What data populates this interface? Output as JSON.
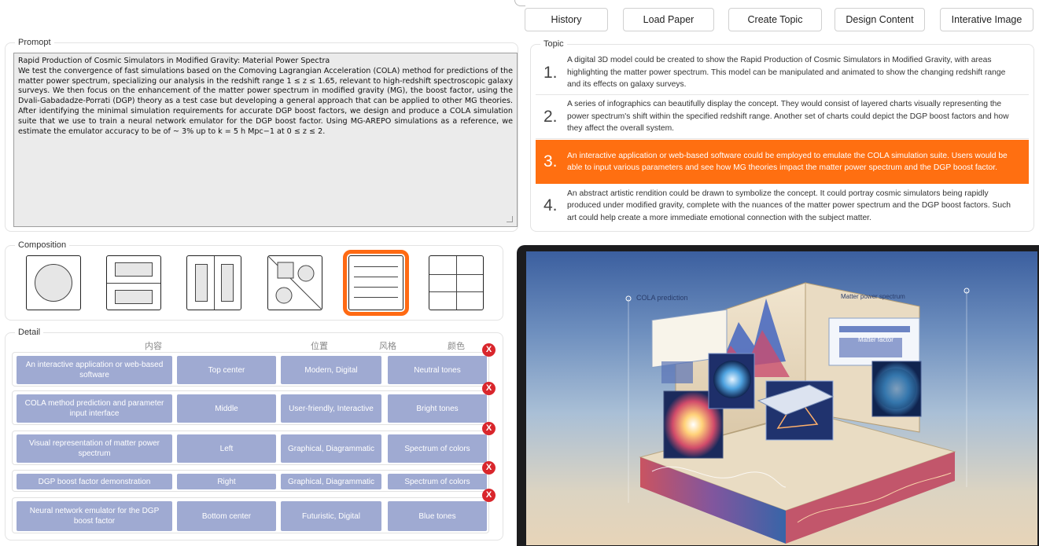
{
  "toolbar": {
    "buttons": [
      "History",
      "Load Paper",
      "Create Topic",
      "Design Content",
      "Interative Image"
    ]
  },
  "prompt": {
    "legend": "Promopt",
    "text": "Rapid Production of Cosmic Simulators in Modified Gravity: Material Power Spectra\nWe test the convergence of fast simulations based on the Comoving Lagrangian Acceleration (COLA) method for predictions of the matter power spectrum, specializing our analysis in the redshift range 1 ≤ z ≤ 1.65, relevant to high-redshift spectroscopic galaxy surveys. We then focus on the enhancement of the matter power spectrum in modified gravity (MG), the boost factor, using the Dvali-Gabadadze-Porrati (DGP) theory as a test case but developing a general approach that can be applied to other MG theories. After identifying the minimal simulation requirements for accurate DGP boost factors, we design and produce a COLA simulation suite that we use to train a neural network emulator for the DGP boost factor. Using MG-AREPO simulations as a reference, we estimate the emulator accuracy to be of ~ 3% up to k = 5 h Mpc−1 at 0 ≤ z ≤ 2."
  },
  "composition": {
    "legend": "Composition",
    "options": [
      "single-circle",
      "two-rows",
      "two-columns",
      "diagonal-split",
      "stacked-rows",
      "grid"
    ],
    "selected_index": 4
  },
  "detail": {
    "legend": "Detail",
    "headers": [
      "内容",
      "位置",
      "风格",
      "颜色"
    ],
    "delete_label": "X",
    "rows": [
      {
        "content": "An interactive application or web-based software",
        "position": "Top center",
        "style": "Modern, Digital",
        "color": "Neutral tones"
      },
      {
        "content": "COLA method prediction and parameter input interface",
        "position": "Middle",
        "style": "User-friendly, Interactive",
        "color": "Bright tones"
      },
      {
        "content": "Visual representation of matter power spectrum",
        "position": "Left",
        "style": "Graphical, Diagrammatic",
        "color": "Spectrum of colors"
      },
      {
        "content": "DGP boost factor demonstration",
        "position": "Right",
        "style": "Graphical, Diagrammatic",
        "color": "Spectrum of colors"
      },
      {
        "content": "Neural network emulator for the DGP boost factor",
        "position": "Bottom center",
        "style": "Futuristic, Digital",
        "color": "Blue tones"
      }
    ]
  },
  "topic": {
    "legend": "Topic",
    "active_index": 2,
    "items": [
      {
        "num": "1.",
        "text": "A digital 3D model could be created to show the Rapid Production of Cosmic Simulators in Modified Gravity, with areas highlighting the matter power spectrum. This model can be manipulated and animated to show the changing redshift range and its effects on galaxy surveys."
      },
      {
        "num": "2.",
        "text": "A series of infographics can beautifully display the concept. They would consist of layered charts visually representing the power spectrum's shift within the specified redshift range. Another set of charts could depict the DGP boost factors and how they affect the overall system."
      },
      {
        "num": "3.",
        "text": "An interactive application or web-based software could be employed to emulate the COLA simulation suite. Users would be able to input various parameters and see how MG theories impact the matter power spectrum and the DGP boost factor."
      },
      {
        "num": "4.",
        "text": "An abstract artistic rendition could be drawn to symbolize the concept. It could portray cosmic simulators being rapidly produced under modified gravity, complete with the nuances of the matter power spectrum and the DGP boost factors. Such art could help create a more immediate emotional connection with the subject matter."
      }
    ]
  },
  "generated_image": {
    "labels": {
      "cola": "COLA prediction",
      "matter": "Matter power spectrum",
      "boost": "Matter factor"
    }
  },
  "colors": {
    "accent": "#ff6f11",
    "cell": "#9faad2",
    "delete": "#d9262c"
  }
}
